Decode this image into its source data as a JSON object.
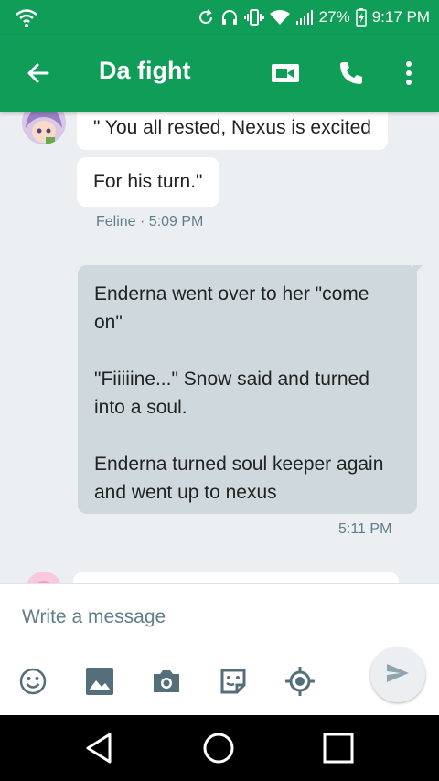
{
  "status_bar": {
    "battery": "27%",
    "time": "9:17 PM"
  },
  "header": {
    "title": "Da fight",
    "icons": [
      "back-arrow-icon",
      "video-call-icon",
      "phone-icon",
      "more-vert-icon"
    ]
  },
  "messages": [
    {
      "direction": "incoming",
      "text": "\" You all rested, Nexus is excited"
    },
    {
      "direction": "incoming",
      "text": "For his turn.\""
    },
    {
      "direction": "incoming",
      "meta": "Feline · 5:09 PM"
    },
    {
      "direction": "outgoing",
      "paragraphs": [
        "Enderna went over to her \"come on\"",
        "\"Fiiiiine...\" Snow said and turned into a soul.",
        "Enderna turned soul keeper again and went up to nexus"
      ],
      "time": "5:11 PM"
    }
  ],
  "composer": {
    "placeholder": "Write a message",
    "tools": [
      "emoji-icon",
      "image-icon",
      "camera-icon",
      "sticker-icon",
      "location-icon",
      "send-icon"
    ]
  },
  "colors": {
    "primary": "#0f9d58",
    "background": "#eceff1",
    "outgoing_bubble": "#cfd8dc",
    "meta_text": "#607d8b"
  }
}
